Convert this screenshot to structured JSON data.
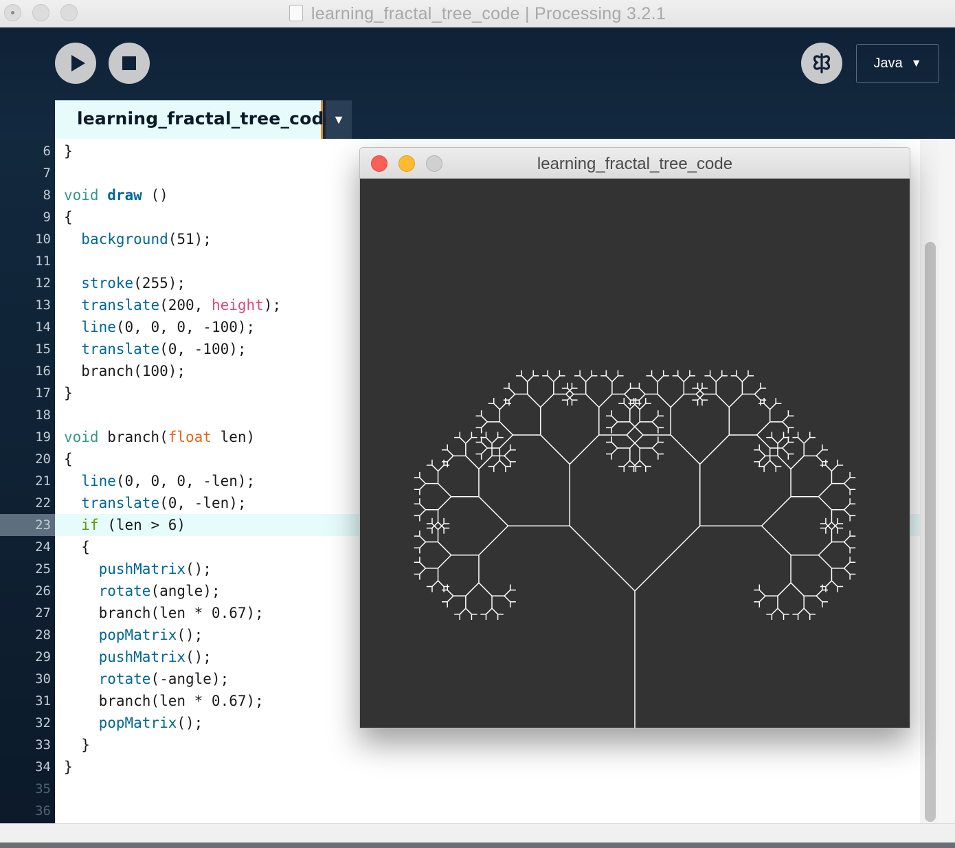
{
  "window": {
    "title": "learning_fractal_tree_code | Processing 3.2.1"
  },
  "toolbar": {
    "run_icon": "play-icon",
    "stop_icon": "stop-icon",
    "debug_icon": "debugger-butterfly-icon",
    "mode_label": "Java",
    "mode_arrow": "▼"
  },
  "tabs": {
    "active_label": "learning_fractal_tree_code",
    "menu_arrow": "▼"
  },
  "editor": {
    "current_line": 23,
    "lines": [
      {
        "n": "6",
        "segs": [
          [
            "}",
            ""
          ]
        ]
      },
      {
        "n": "7",
        "segs": []
      },
      {
        "n": "8",
        "segs": [
          [
            "void",
            "kw"
          ],
          [
            " ",
            ""
          ],
          [
            "draw",
            "fnb"
          ],
          [
            " ()",
            ""
          ]
        ]
      },
      {
        "n": "9",
        "segs": [
          [
            "{",
            ""
          ]
        ]
      },
      {
        "n": "10",
        "segs": [
          [
            "  ",
            ""
          ],
          [
            "background",
            "fn"
          ],
          [
            "(51);",
            ""
          ]
        ]
      },
      {
        "n": "11",
        "segs": []
      },
      {
        "n": "12",
        "segs": [
          [
            "  ",
            ""
          ],
          [
            "stroke",
            "fn"
          ],
          [
            "(255);",
            ""
          ]
        ]
      },
      {
        "n": "13",
        "segs": [
          [
            "  ",
            ""
          ],
          [
            "translate",
            "fn"
          ],
          [
            "(200, ",
            ""
          ],
          [
            "height",
            "const"
          ],
          [
            ");",
            ""
          ]
        ]
      },
      {
        "n": "14",
        "segs": [
          [
            "  ",
            ""
          ],
          [
            "line",
            "fn"
          ],
          [
            "(0, 0, 0, -100);",
            ""
          ]
        ]
      },
      {
        "n": "15",
        "segs": [
          [
            "  ",
            ""
          ],
          [
            "translate",
            "fn"
          ],
          [
            "(0, -100);",
            ""
          ]
        ]
      },
      {
        "n": "16",
        "segs": [
          [
            "  branch(100);",
            ""
          ]
        ]
      },
      {
        "n": "17",
        "segs": [
          [
            "}",
            ""
          ]
        ]
      },
      {
        "n": "18",
        "segs": []
      },
      {
        "n": "19",
        "segs": [
          [
            "void",
            "kw"
          ],
          [
            " branch(",
            ""
          ],
          [
            "float",
            "ty"
          ],
          [
            " len)",
            ""
          ]
        ]
      },
      {
        "n": "20",
        "segs": [
          [
            "{",
            ""
          ]
        ]
      },
      {
        "n": "21",
        "segs": [
          [
            "  ",
            ""
          ],
          [
            "line",
            "fn"
          ],
          [
            "(0, 0, 0, -len);",
            ""
          ]
        ]
      },
      {
        "n": "22",
        "segs": [
          [
            "  ",
            ""
          ],
          [
            "translate",
            "fn"
          ],
          [
            "(0, -len);",
            ""
          ]
        ]
      },
      {
        "n": "23",
        "segs": [
          [
            "  ",
            ""
          ],
          [
            "if",
            "cond"
          ],
          [
            " (len > 6)",
            ""
          ]
        ]
      },
      {
        "n": "24",
        "segs": [
          [
            "  {",
            ""
          ]
        ]
      },
      {
        "n": "25",
        "segs": [
          [
            "    ",
            ""
          ],
          [
            "pushMatrix",
            "fn"
          ],
          [
            "();",
            ""
          ]
        ]
      },
      {
        "n": "26",
        "segs": [
          [
            "    ",
            ""
          ],
          [
            "rotate",
            "fn"
          ],
          [
            "(angle);",
            ""
          ]
        ]
      },
      {
        "n": "27",
        "segs": [
          [
            "    branch(len * 0.67);",
            ""
          ]
        ]
      },
      {
        "n": "28",
        "segs": [
          [
            "    ",
            ""
          ],
          [
            "popMatrix",
            "fn"
          ],
          [
            "();",
            ""
          ]
        ]
      },
      {
        "n": "29",
        "segs": [
          [
            "    ",
            ""
          ],
          [
            "pushMatrix",
            "fn"
          ],
          [
            "();",
            ""
          ]
        ]
      },
      {
        "n": "30",
        "segs": [
          [
            "    ",
            ""
          ],
          [
            "rotate",
            "fn"
          ],
          [
            "(-angle);",
            ""
          ]
        ]
      },
      {
        "n": "31",
        "segs": [
          [
            "    branch(len * 0.67);",
            ""
          ]
        ]
      },
      {
        "n": "32",
        "segs": [
          [
            "    ",
            ""
          ],
          [
            "popMatrix",
            "fn"
          ],
          [
            "();",
            ""
          ]
        ]
      },
      {
        "n": "33",
        "segs": [
          [
            "  }",
            ""
          ]
        ]
      },
      {
        "n": "34",
        "segs": [
          [
            "}",
            ""
          ]
        ]
      },
      {
        "n": "35",
        "segs": [],
        "dim": true
      },
      {
        "n": "36",
        "segs": [],
        "dim": true
      }
    ]
  },
  "sketch_window": {
    "title": "learning_fractal_tree_code",
    "background": "#333333",
    "stroke": "#ffffff",
    "trunk_length": 100,
    "ratio": 0.67,
    "min_length": 6,
    "angle_deg": 45
  },
  "colors": {
    "toolbar_bg": "#13293f",
    "tab_bg": "#e8fbfb",
    "tab_accent": "#e28a2a",
    "keyword": "#33997e",
    "function": "#006699",
    "constant": "#d94a7a",
    "type": "#e2661a",
    "conditional": "#669900"
  }
}
